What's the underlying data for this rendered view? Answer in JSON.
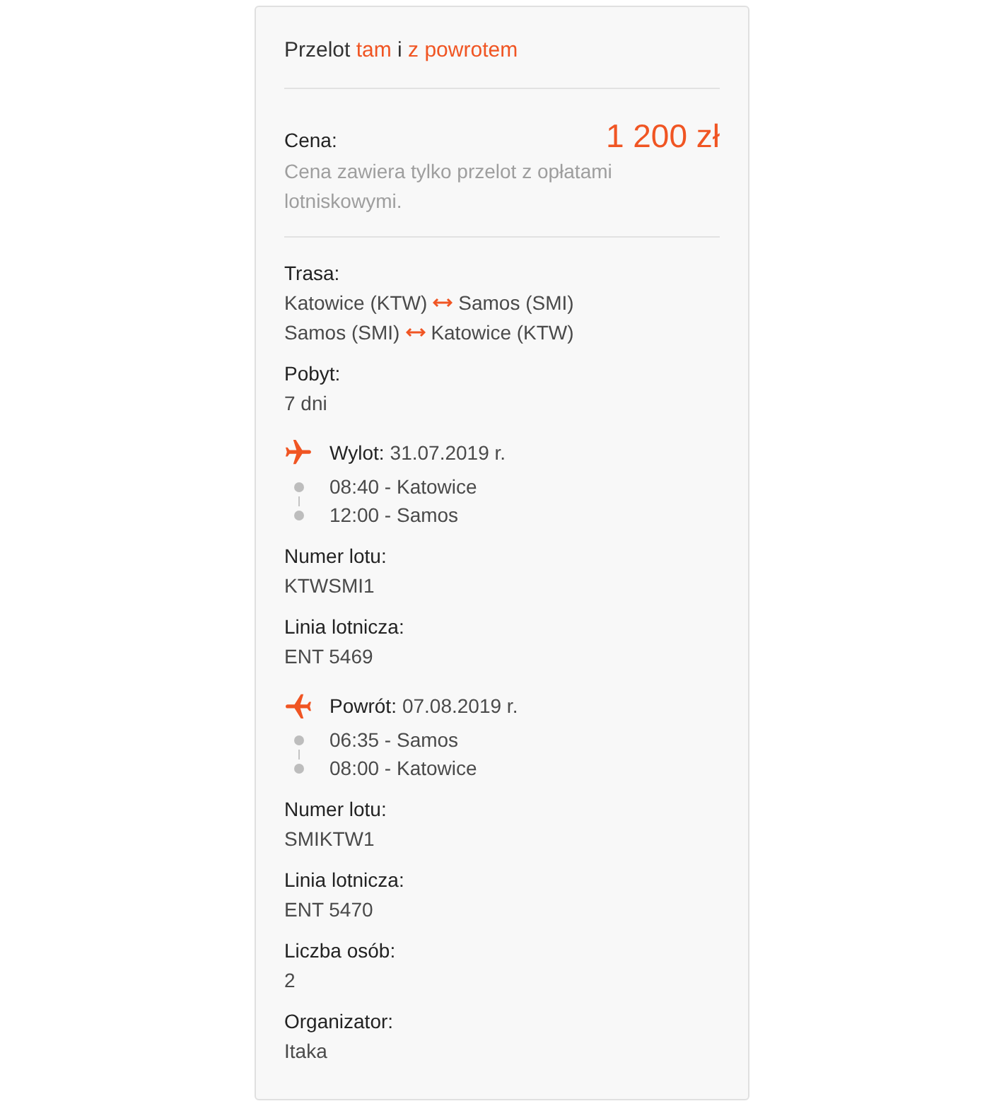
{
  "title": {
    "segments": [
      {
        "text": "Przelot",
        "accent": false
      },
      {
        "text": "tam",
        "accent": true
      },
      {
        "text": "i",
        "accent": false
      },
      {
        "text": "z powrotem",
        "accent": true
      }
    ]
  },
  "price": {
    "label": "Cena:",
    "amount": "1 200 zł",
    "note": "Cena zawiera tylko przelot z opłatami lotniskowymi."
  },
  "details": [
    {
      "kind": "route",
      "label": "Trasa:",
      "legs": [
        {
          "from": "Katowice (KTW)",
          "to": "Samos (SMI)"
        },
        {
          "from": "Samos (SMI)",
          "to": "Katowice (KTW)"
        }
      ]
    },
    {
      "kind": "field",
      "label": "Pobyt:",
      "value": "7 dni"
    },
    {
      "kind": "flight",
      "is_return": false,
      "label": "Wylot:",
      "date": "31.07.2019 r.",
      "stops": [
        "08:40 - Katowice",
        "12:00 - Samos"
      ]
    },
    {
      "kind": "field",
      "label": "Numer lotu:",
      "value": "KTWSMI1"
    },
    {
      "kind": "field",
      "label": "Linia lotnicza:",
      "value": "ENT 5469"
    },
    {
      "kind": "flight",
      "is_return": true,
      "label": "Powrót:",
      "date": "07.08.2019 r.",
      "stops": [
        "06:35 - Samos",
        "08:00 - Katowice"
      ]
    },
    {
      "kind": "field",
      "label": "Numer lotu:",
      "value": "SMIKTW1"
    },
    {
      "kind": "field",
      "label": "Linia lotnicza:",
      "value": "ENT 5470"
    },
    {
      "kind": "field",
      "label": "Liczba osób:",
      "value": "2"
    },
    {
      "kind": "field",
      "label": "Organizator:",
      "value": "Itaka"
    }
  ]
}
